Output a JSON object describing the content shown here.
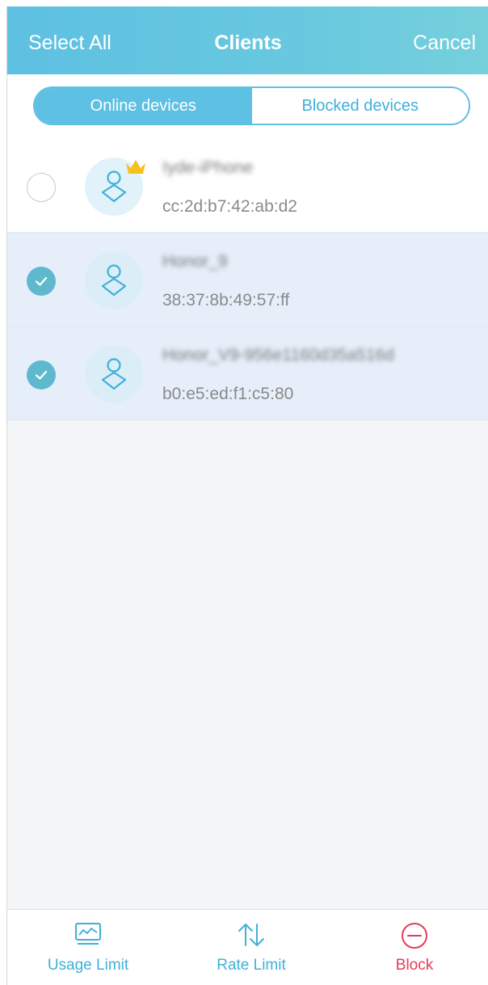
{
  "header": {
    "select_all": "Select All",
    "title": "Clients",
    "cancel": "Cancel"
  },
  "tabs": [
    {
      "label": "Online devices",
      "active": true
    },
    {
      "label": "Blocked devices",
      "active": false
    }
  ],
  "devices": [
    {
      "name": "Iyde-iPhone",
      "mac": "cc:2d:b7:42:ab:d2",
      "selected": false,
      "owner_crown": true
    },
    {
      "name": "Honor_9",
      "mac": "38:37:8b:49:57:ff",
      "selected": true,
      "owner_crown": false
    },
    {
      "name": "Honor_V9-956e1160d35a516d",
      "mac": "b0:e5:ed:f1:c5:80",
      "selected": true,
      "owner_crown": false
    }
  ],
  "toolbar": {
    "usage_limit": "Usage Limit",
    "rate_limit": "Rate Limit",
    "block": "Block"
  },
  "icons": {
    "crown": "crown-icon",
    "avatar": "client-icon",
    "check": "check-icon",
    "usage": "usage-chart-icon",
    "rate": "up-down-arrows-icon",
    "block": "block-icon"
  },
  "colors": {
    "accent": "#5ec0e2",
    "selected_row": "#e6eef9",
    "block": "#e53b5a",
    "crown": "#f5c21b"
  }
}
